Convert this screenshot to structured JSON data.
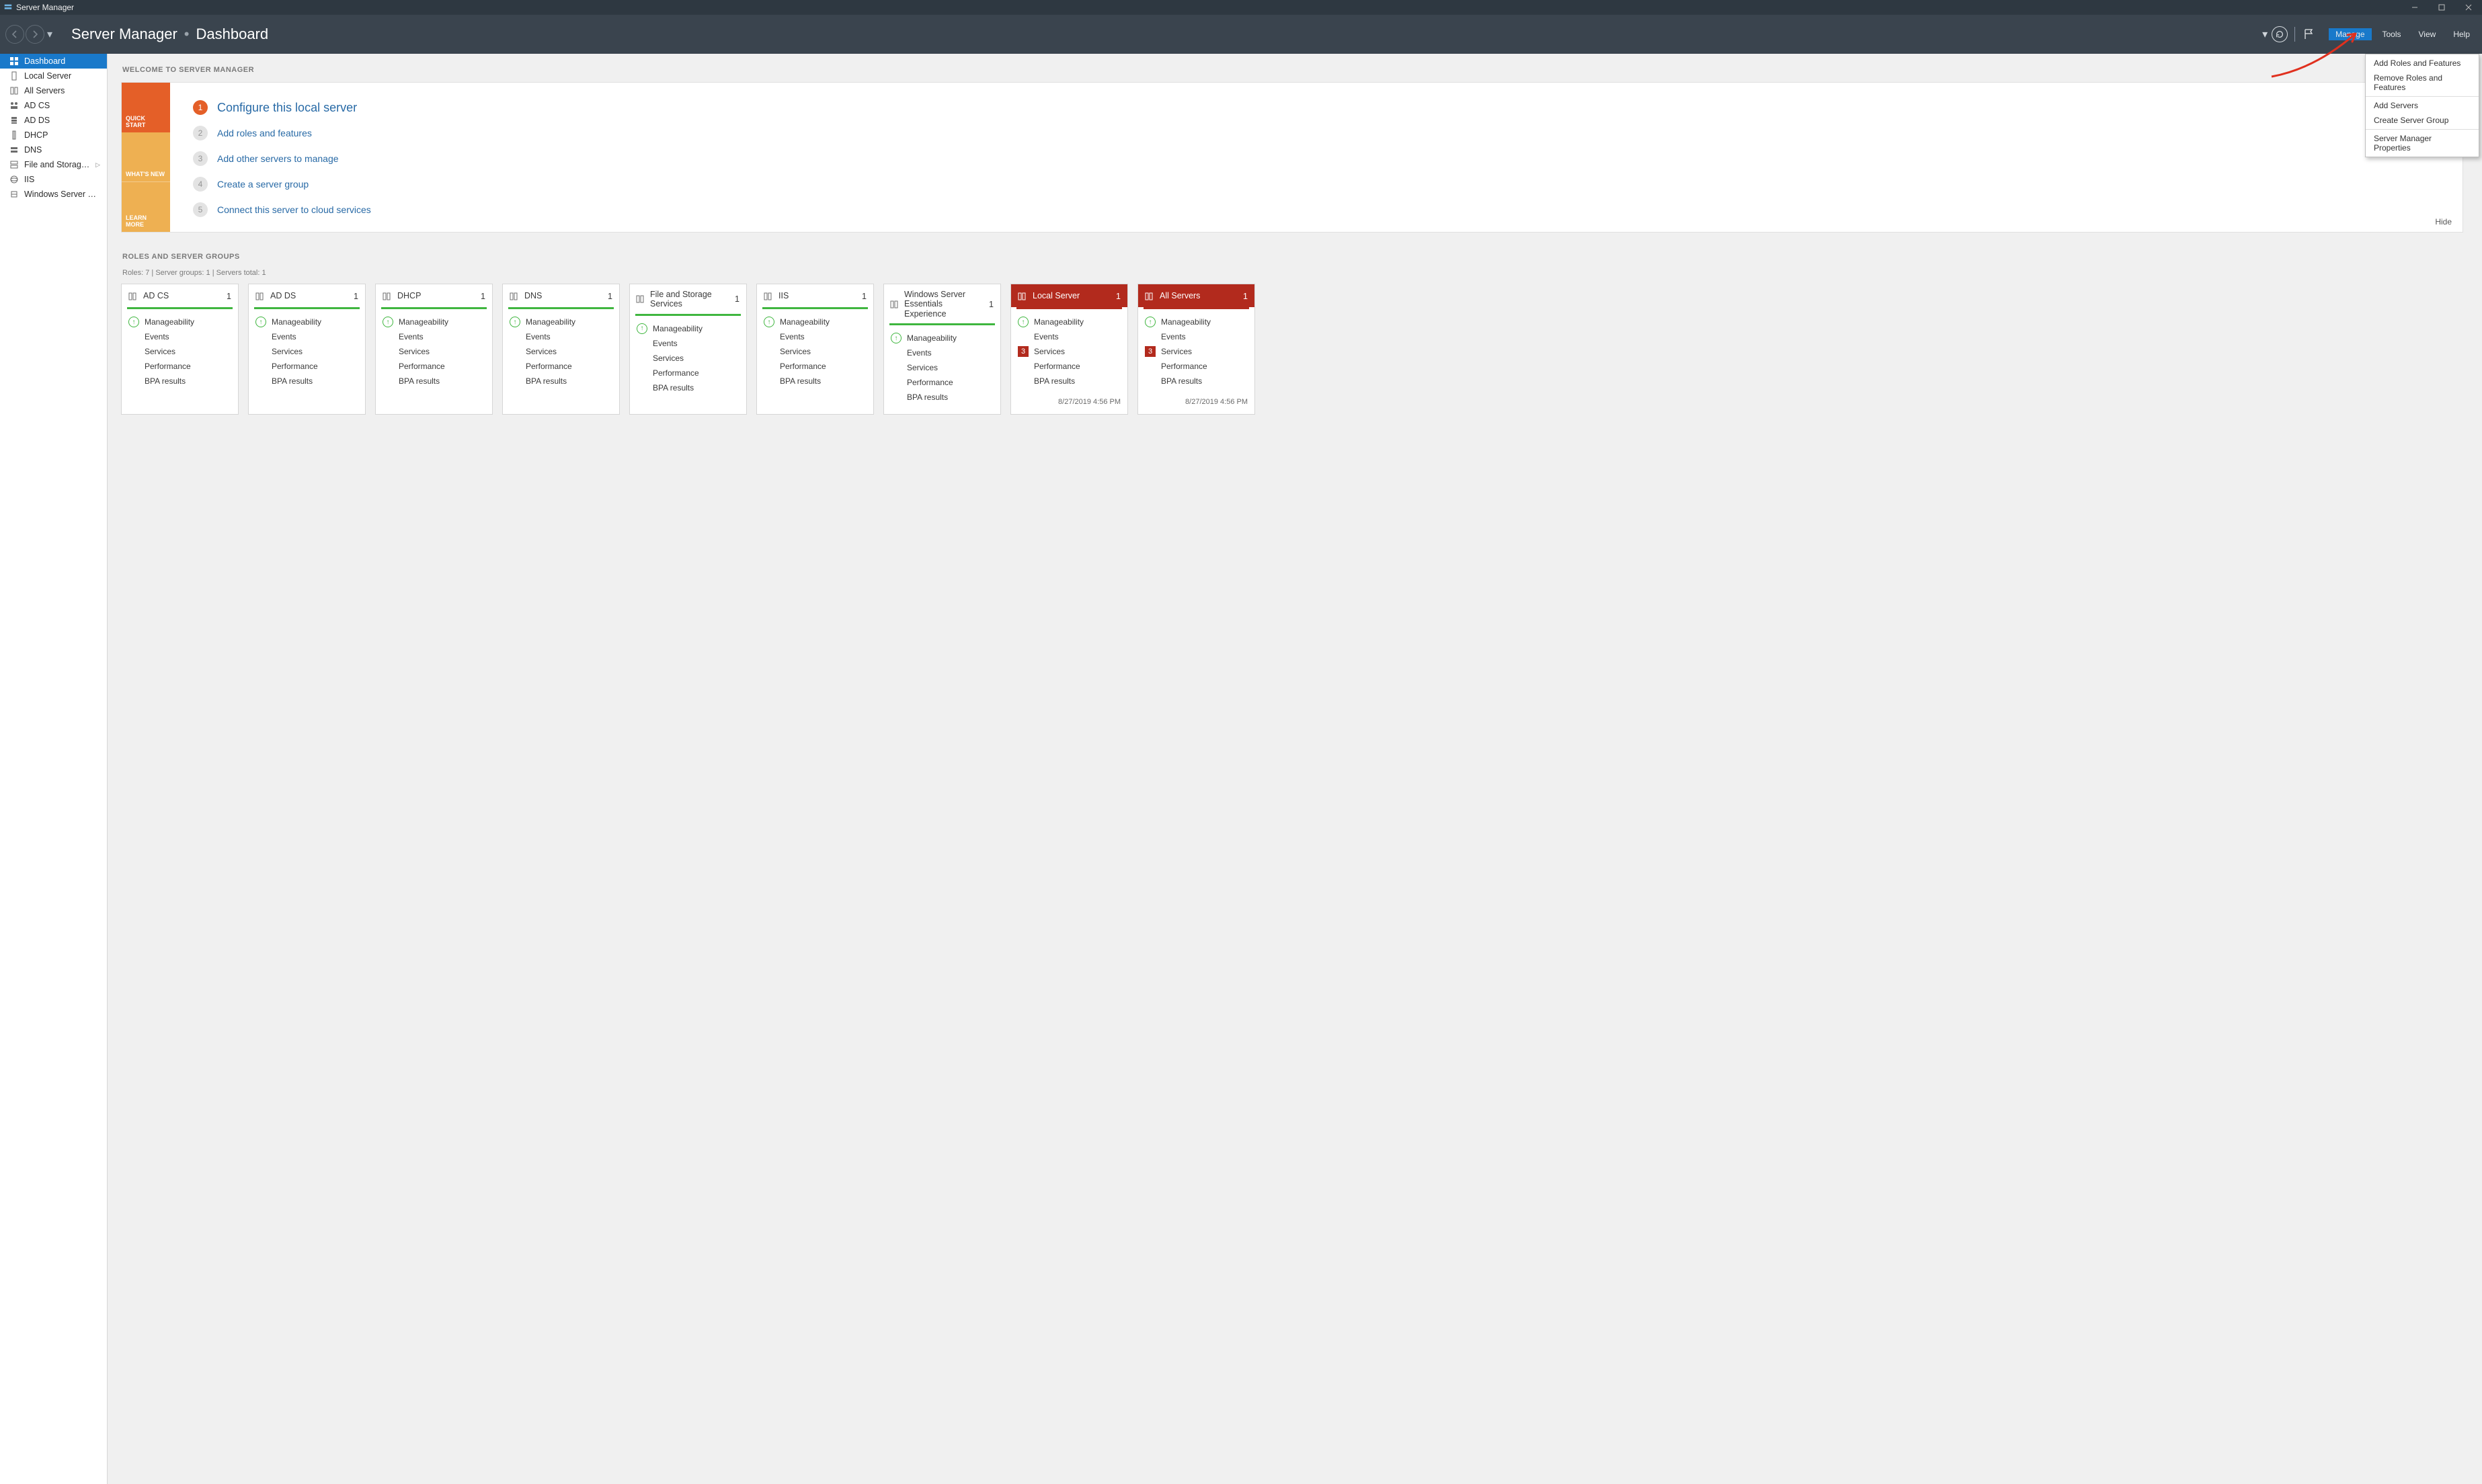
{
  "window": {
    "title": "Server Manager"
  },
  "header": {
    "app_name": "Server Manager",
    "breadcrumb_page": "Dashboard",
    "menus": {
      "manage": "Manage",
      "tools": "Tools",
      "view": "View",
      "help": "Help"
    }
  },
  "manage_menu": {
    "add_roles": "Add Roles and Features",
    "remove_roles": "Remove Roles and Features",
    "add_servers": "Add Servers",
    "create_group": "Create Server Group",
    "props": "Server Manager Properties"
  },
  "sidebar": [
    {
      "label": "Dashboard",
      "icon": "dashboard"
    },
    {
      "label": "Local Server",
      "icon": "server"
    },
    {
      "label": "All Servers",
      "icon": "servers"
    },
    {
      "label": "AD CS",
      "icon": "adcs"
    },
    {
      "label": "AD DS",
      "icon": "adds"
    },
    {
      "label": "DHCP",
      "icon": "dhcp"
    },
    {
      "label": "DNS",
      "icon": "dns"
    },
    {
      "label": "File and Storage Services",
      "icon": "storage",
      "has_sub": true
    },
    {
      "label": "IIS",
      "icon": "iis"
    },
    {
      "label": "Windows Server Essenti...",
      "icon": "wse"
    }
  ],
  "welcome": {
    "header": "WELCOME TO SERVER MANAGER",
    "tabs": {
      "quick": "QUICK START",
      "whats": "WHAT'S NEW",
      "learn": "LEARN MORE"
    },
    "items": {
      "1": "Configure this local server",
      "2": "Add roles and features",
      "3": "Add other servers to manage",
      "4": "Create a server group",
      "5": "Connect this server to cloud services"
    },
    "hide": "Hide"
  },
  "roles": {
    "header": "ROLES AND SERVER GROUPS",
    "sub": "Roles: 7   |   Server groups: 1   |   Servers total: 1",
    "row_labels": {
      "manageability": "Manageability",
      "events": "Events",
      "services": "Services",
      "performance": "Performance",
      "bpa": "BPA results"
    },
    "tiles": [
      {
        "title": "AD CS",
        "count": "1",
        "style": "green"
      },
      {
        "title": "AD DS",
        "count": "1",
        "style": "green"
      },
      {
        "title": "DHCP",
        "count": "1",
        "style": "green"
      },
      {
        "title": "DNS",
        "count": "1",
        "style": "green"
      },
      {
        "title": "File and Storage Services",
        "count": "1",
        "style": "green"
      },
      {
        "title": "IIS",
        "count": "1",
        "style": "green"
      },
      {
        "title": "Windows Server Essentials Experience",
        "count": "1",
        "style": "green"
      },
      {
        "title": "Local Server",
        "count": "1",
        "style": "red",
        "svc_badge": "3",
        "ts": "8/27/2019 4:56 PM"
      },
      {
        "title": "All Servers",
        "count": "1",
        "style": "red",
        "svc_badge": "3",
        "ts": "8/27/2019 4:56 PM"
      }
    ]
  }
}
